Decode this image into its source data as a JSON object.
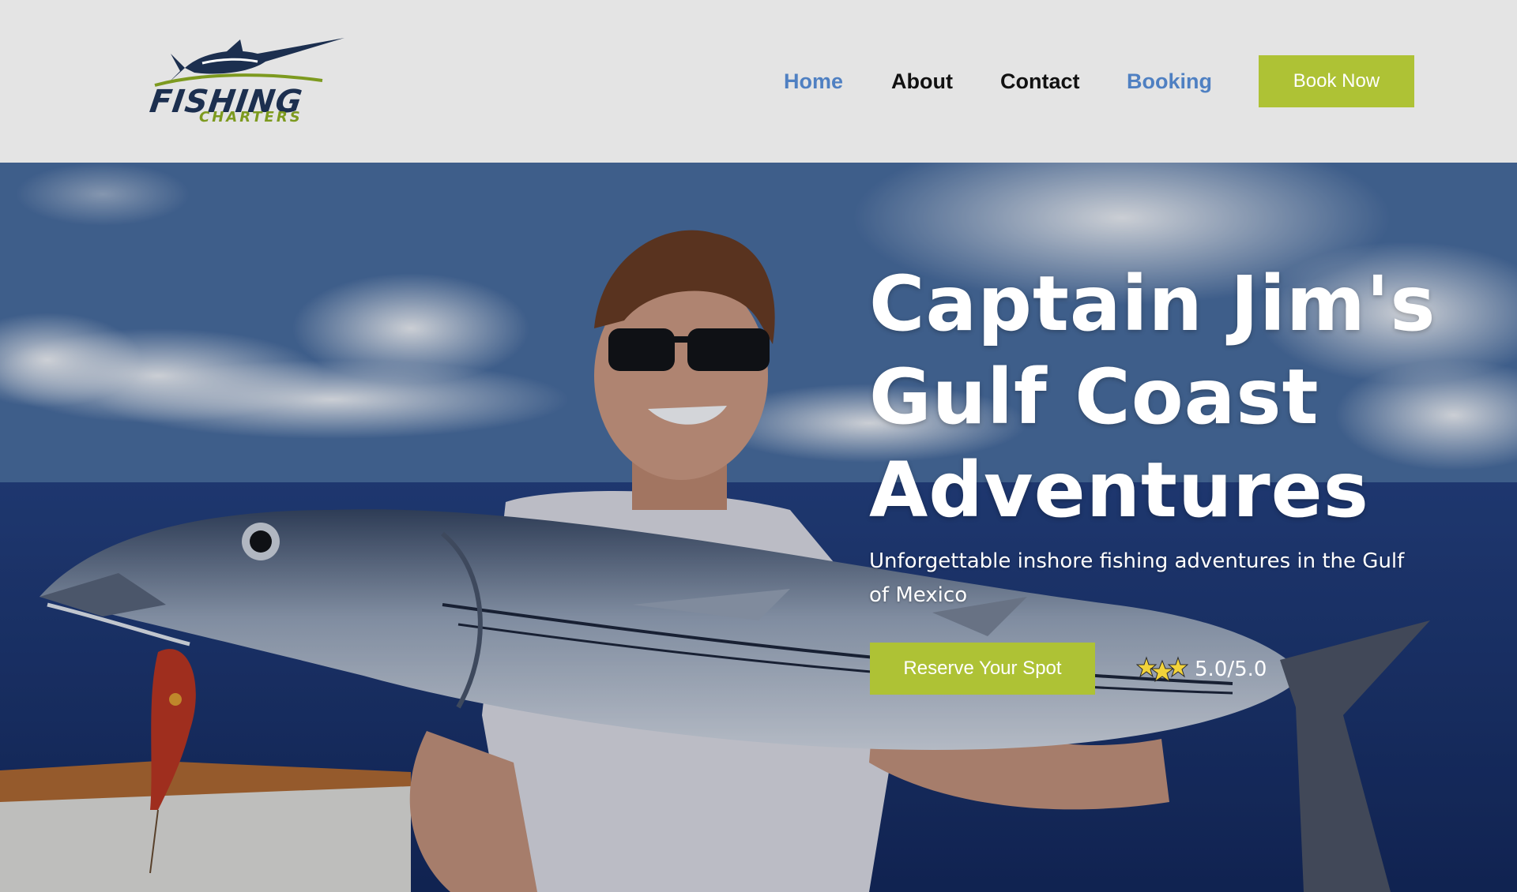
{
  "header": {
    "logo": {
      "word": "FISHING",
      "sub": "CHARTERS"
    },
    "nav": [
      {
        "label": "Home",
        "state": "active"
      },
      {
        "label": "About",
        "state": "default"
      },
      {
        "label": "Contact",
        "state": "default"
      },
      {
        "label": "Booking",
        "state": "active"
      }
    ],
    "cta_label": "Book Now"
  },
  "hero": {
    "headline_lines": [
      "Captain Jim's",
      "Gulf Coast",
      "Adventures"
    ],
    "subtitle": "Unforgettable inshore fishing adventures in the Gulf of Mexico",
    "cta_label": "Reserve Your Spot",
    "rating_text": "5.0/5.0",
    "rating_icon": "star-icon"
  },
  "colors": {
    "accent": "#aec235",
    "nav_active": "#4f80c2",
    "nav_default": "#111111",
    "header_bg": "#e4e4e4",
    "logo_navy": "#1c2f4f",
    "logo_green": "#7d9a1f"
  }
}
